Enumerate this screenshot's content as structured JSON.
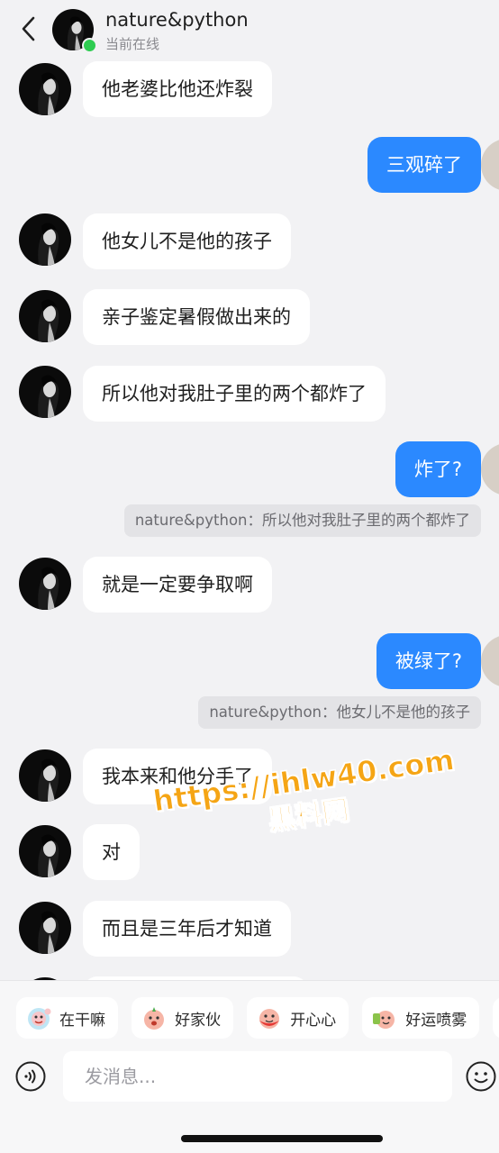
{
  "header": {
    "contact_name": "nature&python",
    "status": "当前在线"
  },
  "messages": [
    {
      "direction": "in",
      "text": "他老婆比他还炸裂"
    },
    {
      "direction": "out",
      "text": "三观碎了"
    },
    {
      "direction": "in",
      "text": "他女儿不是他的孩子"
    },
    {
      "direction": "in",
      "text": "亲子鉴定暑假做出来的"
    },
    {
      "direction": "in",
      "text": "所以他对我肚子里的两个都炸了"
    },
    {
      "direction": "out",
      "text": "炸了?",
      "quote": "nature&python：所以他对我肚子里的两个都炸了"
    },
    {
      "direction": "in",
      "text": "就是一定要争取啊"
    },
    {
      "direction": "out",
      "text": "被绿了?",
      "quote": "nature&python：他女儿不是他的孩子"
    },
    {
      "direction": "in",
      "text": "我本来和他分手了"
    },
    {
      "direction": "in",
      "text": "对"
    },
    {
      "direction": "in",
      "text": "而且是三年后才知道"
    }
  ],
  "watermark": {
    "line1": "https://ihlw40.com",
    "line2": "黑料网"
  },
  "quick_replies": [
    {
      "label": "在干嘛",
      "icon": "sticker-waving-icon"
    },
    {
      "label": "好家伙",
      "icon": "sticker-surprised-icon"
    },
    {
      "label": "开心心",
      "icon": "sticker-happy-icon"
    },
    {
      "label": "好运喷雾",
      "icon": "sticker-lucky-icon"
    }
  ],
  "composer": {
    "placeholder": "发消息..."
  },
  "colors": {
    "background": "#f2f2f4",
    "outgoing_bubble": "#2b89ff",
    "incoming_bubble": "#ffffff",
    "online_dot": "#2ecc51",
    "watermark": "#f5a515"
  }
}
